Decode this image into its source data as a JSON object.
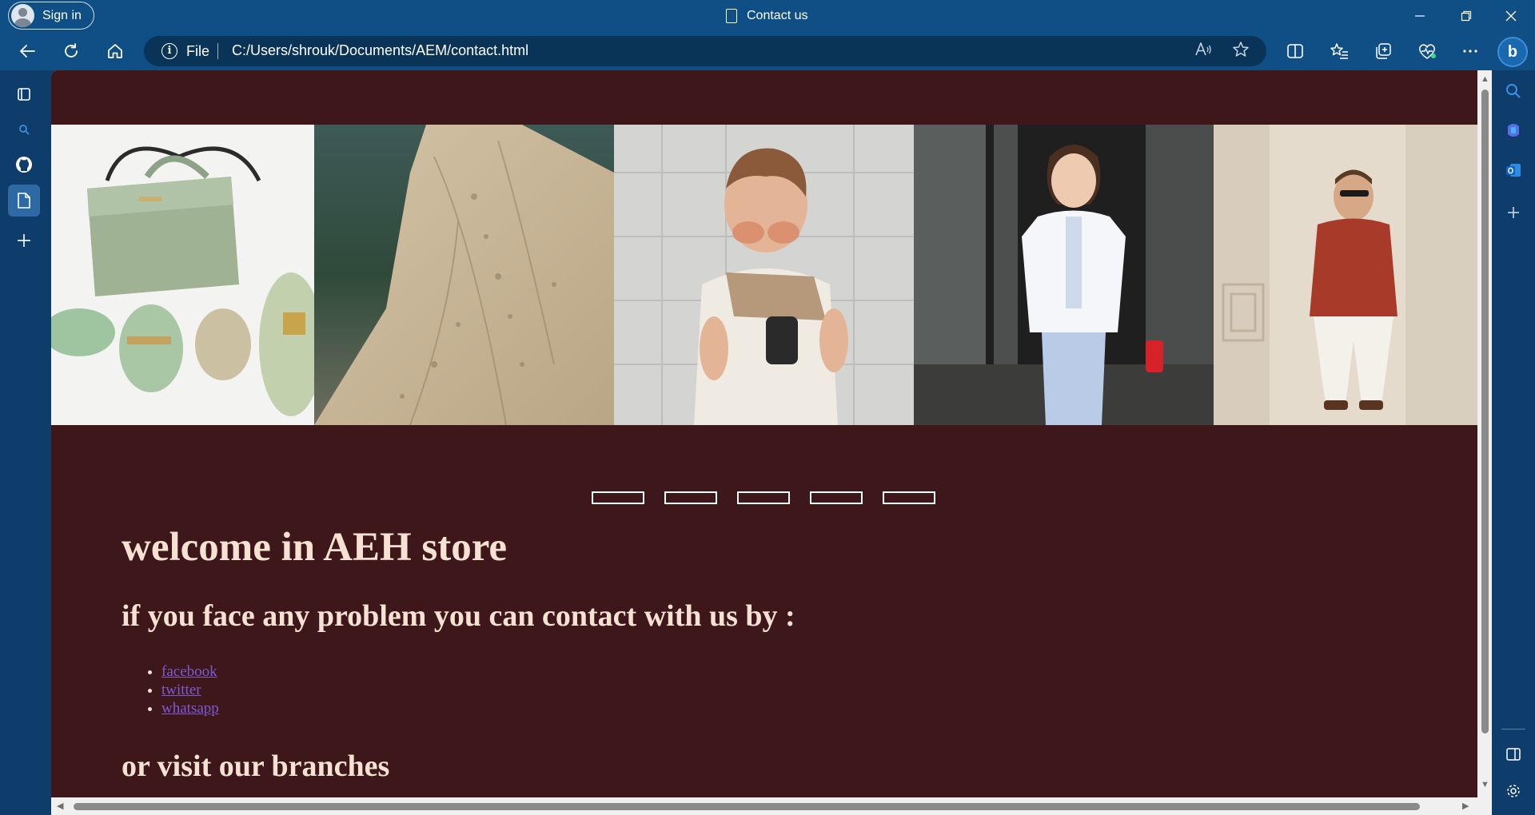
{
  "browser": {
    "signin_label": "Sign in",
    "tab_title": "Contact us",
    "scheme_label": "File",
    "url": "C:/Users/shrouk/Documents/AEM/contact.html"
  },
  "page": {
    "heading": "welcome in AEH store",
    "contact_text": "if you face any problem you can contact with us by :",
    "links": [
      "facebook",
      "twitter",
      "whatsapp"
    ],
    "branches_text": "or visit our branches",
    "slider_dot_count": 5,
    "gallery": [
      "green-handbag-and-sandals",
      "embroidered-evening-dress",
      "boy-in-sunglasses",
      "girl-in-white-blouse",
      "man-in-red-blazer"
    ]
  },
  "colors": {
    "page_background": "#3d1719",
    "text": "#f6e1d2",
    "link": "#7e5ad8",
    "browser_frame": "#0f4f86"
  }
}
